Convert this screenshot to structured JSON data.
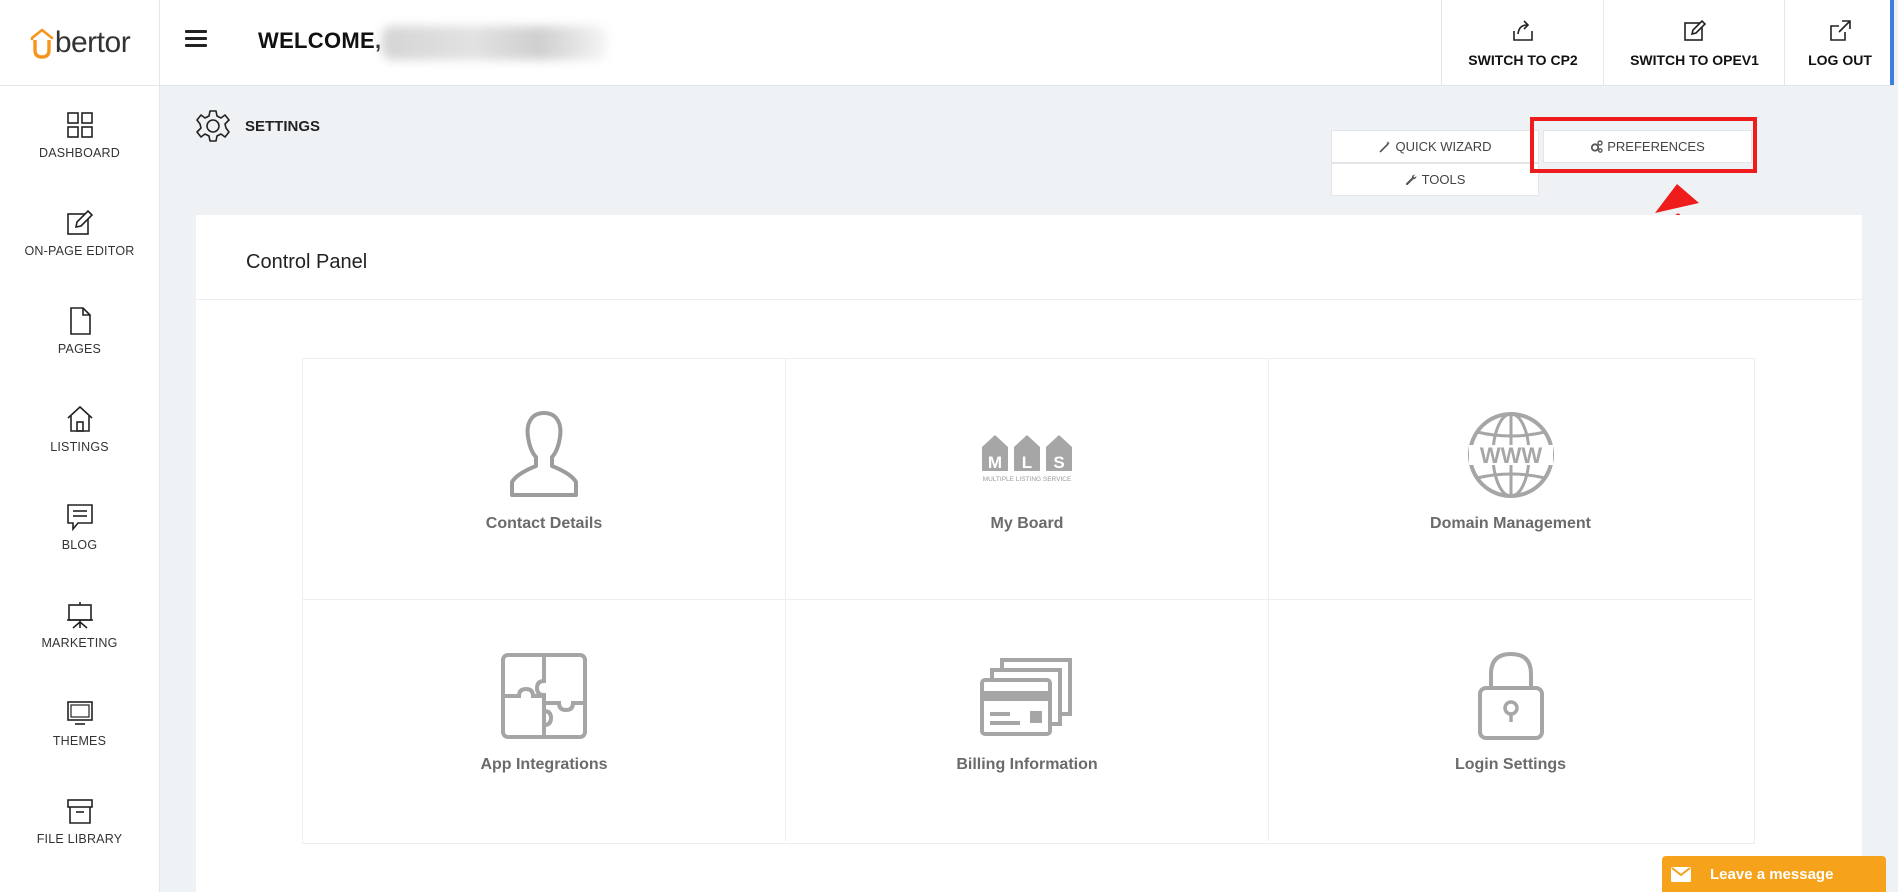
{
  "brand": {
    "logo_text": "bertor",
    "accent": "#f7941d"
  },
  "header": {
    "welcome": "WELCOME,",
    "actions": [
      {
        "label": "SWITCH TO CP2",
        "icon": "switch-upload-icon"
      },
      {
        "label": "SWITCH TO OPEV1",
        "icon": "edit-icon"
      },
      {
        "label": "LOG OUT",
        "icon": "external-link-icon"
      }
    ]
  },
  "sidebar": {
    "items": [
      {
        "label": "DASHBOARD",
        "icon": "dashboard-grid-icon"
      },
      {
        "label": "ON-PAGE EDITOR",
        "icon": "pencil-square-icon"
      },
      {
        "label": "PAGES",
        "icon": "page-icon"
      },
      {
        "label": "LISTINGS",
        "icon": "house-icon"
      },
      {
        "label": "BLOG",
        "icon": "chat-bubble-icon"
      },
      {
        "label": "MARKETING",
        "icon": "presentation-board-icon"
      },
      {
        "label": "THEMES",
        "icon": "monitor-icon"
      },
      {
        "label": "FILE LIBRARY",
        "icon": "archive-box-icon"
      }
    ]
  },
  "settings": {
    "title": "SETTINGS",
    "tabs": {
      "quick_wizard": "QUICK WIZARD",
      "preferences": "PREFERENCES",
      "tools": "TOOLS"
    }
  },
  "annotation": {
    "highlight_color": "#ee1c1c"
  },
  "panel": {
    "title": "Control Panel",
    "cards": [
      {
        "label": "Contact Details",
        "icon": "person-silhouette-icon"
      },
      {
        "label": "My Board",
        "icon": "mls-logo-icon"
      },
      {
        "label": "Domain Management",
        "icon": "www-globe-icon"
      },
      {
        "label": "App Integrations",
        "icon": "puzzle-icon"
      },
      {
        "label": "Billing Information",
        "icon": "credit-card-icon"
      },
      {
        "label": "Login Settings",
        "icon": "padlock-icon"
      }
    ],
    "mls_text": {
      "m": "M",
      "l": "L",
      "s": "S",
      "caption": "MULTIPLE LISTING SERVICE"
    },
    "www_text": "WWW"
  },
  "chat": {
    "label": "Leave a message",
    "color": "#f7a21b"
  }
}
